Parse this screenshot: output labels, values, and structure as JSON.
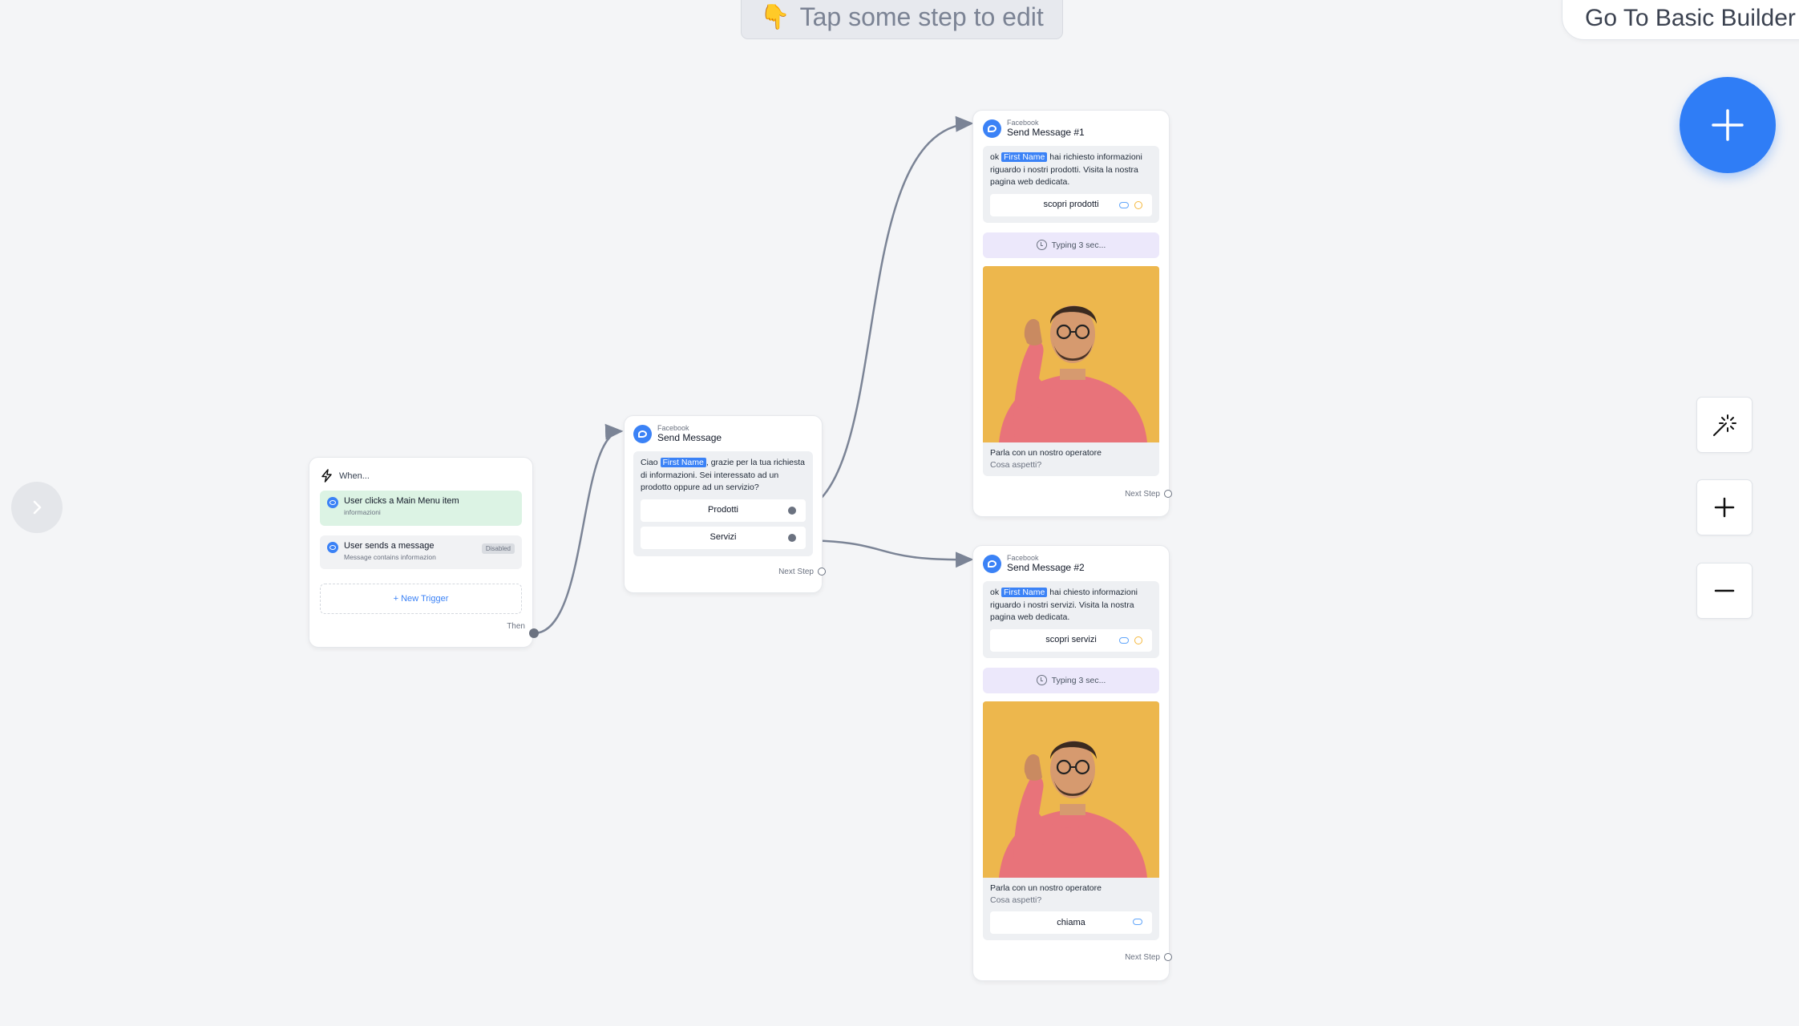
{
  "hint": {
    "emoji": "👇",
    "text": "Tap some step to edit"
  },
  "top_right": {
    "basic_builder_label": "Go To Basic Builder"
  },
  "colors": {
    "accent": "#2f7df6",
    "canvas": "#f4f5f7",
    "trigger_active": "#dcf3e4",
    "typing_bg": "#ece8fb"
  },
  "trigger": {
    "title": "When...",
    "items": [
      {
        "title": "User clicks a Main Menu item",
        "subtitle": "informazioni",
        "active": true
      },
      {
        "title": "User sends a message",
        "subtitle": "Message contains informazion",
        "badge": "Disabled"
      }
    ],
    "new_trigger": "+ New Trigger",
    "then": "Then"
  },
  "step_main": {
    "source": "Facebook",
    "title": "Send Message",
    "text_pre": "Ciao ",
    "tag": "First Name",
    "text_post": ", grazie per la tua richiesta di informazioni. Sei interessato ad un prodotto oppure ad un servizio?",
    "buttons": [
      "Prodotti",
      "Servizi"
    ],
    "next": "Next Step"
  },
  "step1": {
    "source": "Facebook",
    "title": "Send Message #1",
    "text_pre": "ok ",
    "tag": "First Name",
    "text_post": " hai richiesto informazioni riguardo i nostri prodotti. Visita la nostra pagina web dedicata.",
    "button": "scopri prodotti",
    "typing": "Typing 3 sec...",
    "caption_title": "Parla con un nostro operatore",
    "caption_sub": "Cosa aspetti?",
    "next": "Next Step"
  },
  "step2": {
    "source": "Facebook",
    "title": "Send Message #2",
    "text_pre": "ok ",
    "tag": "First Name",
    "text_post": " hai chiesto informazioni riguardo i nostri servizi. Visita la nostra pagina web dedicata.",
    "button": "scopri servizi",
    "typing": "Typing 3 sec...",
    "caption_title": "Parla con un nostro operatore",
    "caption_sub": "Cosa aspetti?",
    "call_button": "chiama",
    "next": "Next Step"
  },
  "icons": {
    "fab": "plus-icon",
    "magic": "magic-wand-icon",
    "zoom_in": "plus-icon",
    "zoom_out": "minus-icon",
    "sidebar": "chevron-right-icon",
    "trigger": "lightning-icon",
    "messenger": "messenger-icon"
  }
}
